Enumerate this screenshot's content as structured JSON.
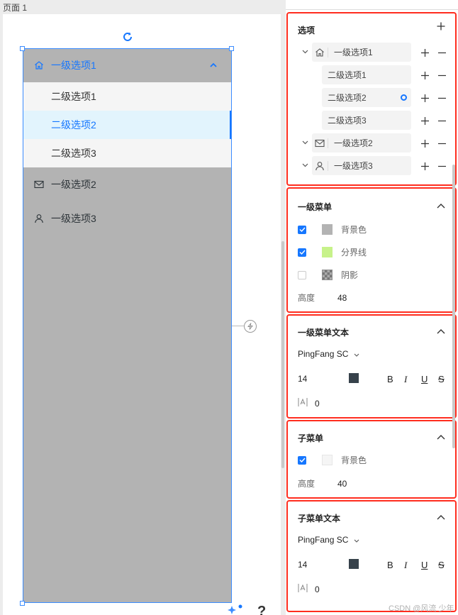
{
  "page": {
    "title": "页面 1"
  },
  "menu": {
    "items": [
      {
        "label": "一级选项1",
        "icon": "home-icon",
        "expanded": true
      },
      {
        "label": "一级选项2",
        "icon": "mail-icon"
      },
      {
        "label": "一级选项3",
        "icon": "user-icon"
      }
    ],
    "subitems": [
      "二级选项1",
      "二级选项2",
      "二级选项3"
    ],
    "selected_subitem": "二级选项2"
  },
  "options_panel": {
    "title": "选项",
    "tree": [
      {
        "label": "一级选项1",
        "icon": "home-icon"
      },
      {
        "label": "二级选项1"
      },
      {
        "label": "二级选项2",
        "selected_marker": true
      },
      {
        "label": "二级选项3"
      },
      {
        "label": "一级选项2",
        "icon": "mail-icon"
      },
      {
        "label": "一级选项3",
        "icon": "user-icon"
      }
    ]
  },
  "level1_menu": {
    "title": "一级菜单",
    "bg_label": "背景色",
    "bg_checked": true,
    "bg_color": "#b3b3b3",
    "divider_label": "分界线",
    "divider_checked": true,
    "divider_color": "#c7f28a",
    "shadow_label": "阴影",
    "shadow_checked": false,
    "height_label": "高度",
    "height_value": "48"
  },
  "level1_text": {
    "title": "一级菜单文本",
    "font": "PingFang SC",
    "size": "14",
    "color": "#37424b",
    "bold": "B",
    "italic": "I",
    "underline": "U",
    "strike": "S",
    "spacing": "0"
  },
  "submenu": {
    "title": "子菜单",
    "bg_label": "背景色",
    "bg_checked": true,
    "bg_color": "#f5f5f5",
    "height_label": "高度",
    "height_value": "40"
  },
  "submenu_text": {
    "title": "子菜单文本",
    "font": "PingFang SC",
    "size": "14",
    "color": "#37424b",
    "bold": "B",
    "italic": "I",
    "underline": "U",
    "strike": "S",
    "spacing": "0"
  },
  "colors": {
    "accent": "#1677ff",
    "highlight_border": "#ff2d1f",
    "menu_bg": "#b3b3b3",
    "sub_bg": "#f5f5f5",
    "sub_selected_bg": "#e2f4fd"
  },
  "watermark": "CSDN @风流 少年",
  "help_label": "?"
}
